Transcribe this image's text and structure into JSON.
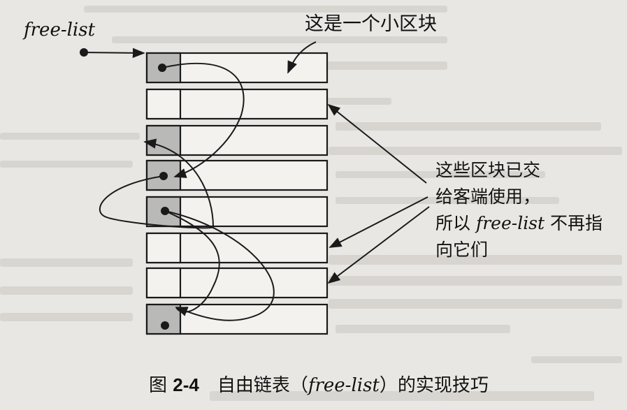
{
  "diagram": {
    "freelist_label": "free-list",
    "small_block_note": "这是一个小区块",
    "allocated_note": {
      "line1": "这些区块已交",
      "line2": "给客端使用，",
      "line3_prefix": "所以 ",
      "line3_italic": "free-list",
      "line3_suffix": " 不再指",
      "line4": "向它们"
    },
    "blocks": [
      {
        "id": "block-1",
        "head": "gray",
        "has_pointer": true
      },
      {
        "id": "block-2",
        "head": "white",
        "has_pointer": false
      },
      {
        "id": "block-3",
        "head": "gray",
        "has_pointer": false
      },
      {
        "id": "block-4",
        "head": "gray",
        "has_pointer": true
      },
      {
        "id": "block-5",
        "head": "gray",
        "has_pointer": true
      },
      {
        "id": "block-6",
        "head": "white",
        "has_pointer": false
      },
      {
        "id": "block-7",
        "head": "white",
        "has_pointer": false
      },
      {
        "id": "block-8",
        "head": "gray",
        "has_pointer": true
      }
    ],
    "links": [
      {
        "from": "free-list",
        "to": "block-1"
      },
      {
        "from": "block-1",
        "to": "block-4"
      },
      {
        "from": "block-4",
        "to": "block-3"
      },
      {
        "from": "block-5",
        "to": "block-8"
      }
    ],
    "allocated_blocks": [
      "block-2",
      "block-6",
      "block-7"
    ]
  },
  "caption": {
    "prefix": "图 ",
    "number": "2-4",
    "title_before": "自由链表（",
    "title_italic": "free-list",
    "title_after": "）的实现技巧"
  },
  "colors": {
    "background": "#e9e7e4",
    "block_fill": "#f3f2ef",
    "block_head_gray": "#b9b9b7",
    "ink": "#1a1a1a"
  }
}
